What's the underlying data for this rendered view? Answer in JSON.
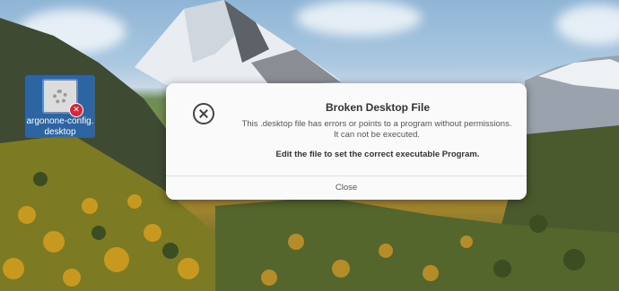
{
  "desktop": {
    "icon": {
      "icon_name": "settings-file-icon",
      "badge_icon": "error-x-icon",
      "label_line1": "argonone-config.",
      "label_line2": "desktop"
    }
  },
  "dialog": {
    "icon_name": "circle-x-icon",
    "title": "Broken Desktop File",
    "body_line1": "This .desktop file has errors or points to a program without permissions.",
    "body_line2": "It can not be executed.",
    "hint": "Edit the file to set the correct executable Program.",
    "close_label": "Close"
  },
  "colors": {
    "dialog_bg": "#fafafa",
    "selection_blue": "#2f6ec5",
    "error_badge": "#d9263b"
  }
}
